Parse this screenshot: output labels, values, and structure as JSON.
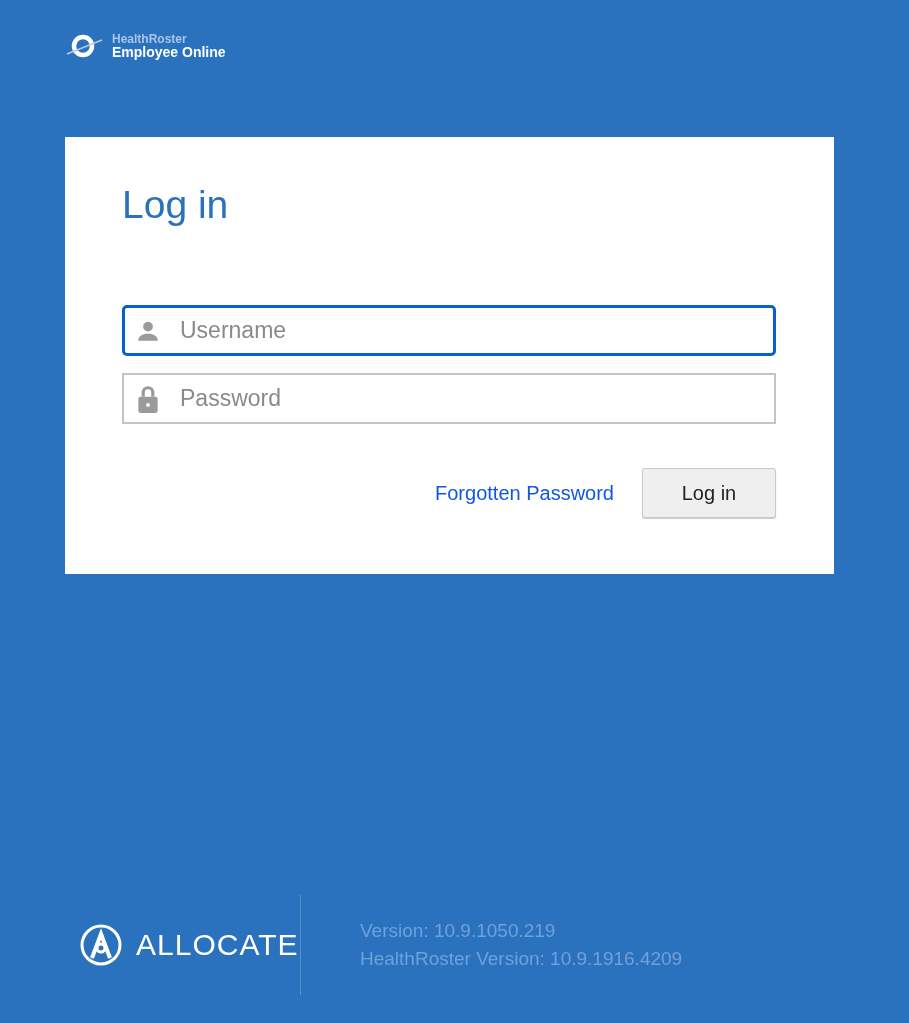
{
  "header": {
    "logo_line_1": "HealthRoster",
    "logo_line_2": "Employee Online"
  },
  "login_card": {
    "title": "Log in",
    "fields": [
      {
        "kind": "user",
        "placeholder": "Username",
        "focused": true
      },
      {
        "kind": "lock",
        "placeholder": "Password",
        "focused": false
      }
    ],
    "forgot_link": "Forgotten Password",
    "submit_button": "Log in"
  },
  "footer": {
    "brand": "ALLOCATE",
    "versions": [
      "Version: 10.9.1050.219",
      "HealthRoster Version: 10.9.1916.4209"
    ]
  }
}
